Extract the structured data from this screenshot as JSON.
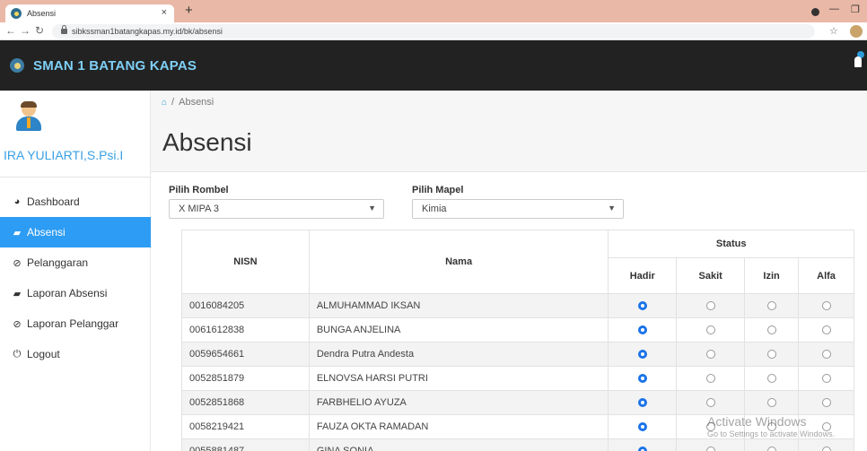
{
  "browser": {
    "tab_title": "Absensi",
    "tab_close": "×",
    "new_tab": "+",
    "url": "sibkssman1batangkapas.my.id/bk/absensi"
  },
  "header": {
    "brand": "SMAN 1 BATANG KAPAS"
  },
  "sidebar": {
    "user_name": "IRA YULIARTI,S.Psi.I",
    "items": [
      {
        "label": "Dashboard",
        "icon": "tachometer-icon",
        "active": false
      },
      {
        "label": "Absensi",
        "icon": "book-icon",
        "active": true
      },
      {
        "label": "Pelanggaran",
        "icon": "ban-icon",
        "active": false
      },
      {
        "label": "Laporan Absensi",
        "icon": "book-icon",
        "active": false
      },
      {
        "label": "Laporan Pelanggar",
        "icon": "ban-icon",
        "active": false
      },
      {
        "label": "Logout",
        "icon": "power-icon",
        "active": false
      }
    ]
  },
  "breadcrumb": {
    "separator": "/",
    "current": "Absensi"
  },
  "page": {
    "title": "Absensi"
  },
  "filters": {
    "rombel_label": "Pilih Rombel",
    "rombel_value": "X MIPA 3",
    "mapel_label": "Pilih Mapel",
    "mapel_value": "Kimia"
  },
  "table": {
    "headers": {
      "nisn": "NISN",
      "nama": "Nama",
      "status": "Status",
      "hadir": "Hadir",
      "sakit": "Sakit",
      "izin": "Izin",
      "alfa": "Alfa"
    },
    "rows": [
      {
        "nisn": "0016084205",
        "nama": "ALMUHAMMAD IKSAN",
        "status": "hadir"
      },
      {
        "nisn": "0061612838",
        "nama": "BUNGA ANJELINA",
        "status": "hadir"
      },
      {
        "nisn": "0059654661",
        "nama": "Dendra Putra Andesta",
        "status": "hadir"
      },
      {
        "nisn": "0052851879",
        "nama": "ELNOVSA HARSI PUTRI",
        "status": "hadir"
      },
      {
        "nisn": "0052851868",
        "nama": "FARBHELIO AYUZA",
        "status": "hadir"
      },
      {
        "nisn": "0058219421",
        "nama": "FAUZA OKTA RAMADAN",
        "status": "hadir"
      },
      {
        "nisn": "0055881487",
        "nama": "GINA SONIA",
        "status": "hadir"
      }
    ]
  },
  "watermark": {
    "line1": "Activate Windows",
    "line2": "Go to Settings to activate Windows."
  },
  "colors": {
    "accent": "#2d9cf4",
    "header_bg": "#222222",
    "brand": "#7fd0f7",
    "tab_strip": "#eab8a6"
  }
}
